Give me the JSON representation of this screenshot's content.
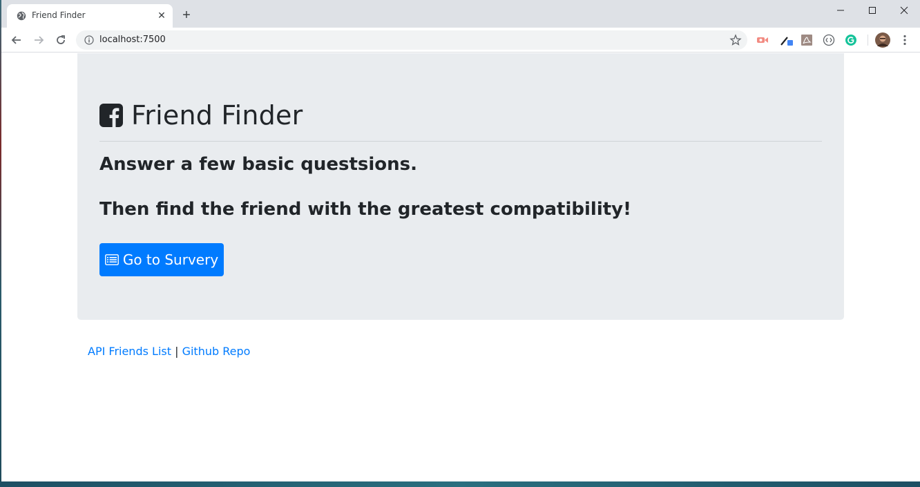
{
  "browser": {
    "tab_title": "Friend Finder",
    "tab_close": "✕",
    "new_tab": "+",
    "url": "localhost:7500",
    "window_controls": [
      "minimize-icon",
      "maximize-icon",
      "close-icon"
    ],
    "extensions": [
      "cast-icon",
      "eyedropper-icon",
      "pdf-icon",
      "code-icon",
      "grammarly-icon"
    ]
  },
  "hero": {
    "title": "Friend Finder",
    "icon": "facebook-square-icon",
    "line1": "Answer a few basic questsions.",
    "line2": "Then find the friend with the greatest compatibility!",
    "button_label": "Go to Survery",
    "button_icon": "list-alt-icon"
  },
  "footer": {
    "link1": "API Friends List",
    "separator": "|",
    "link2": "Github Repo"
  },
  "colors": {
    "primary": "#007bff",
    "jumbotron_bg": "#e9ecef",
    "text": "#212529"
  }
}
